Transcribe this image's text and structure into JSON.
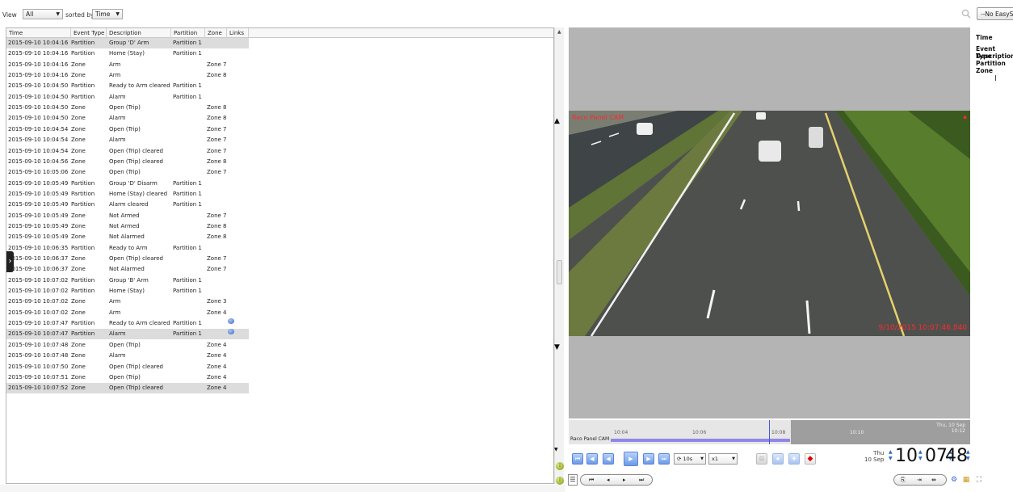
{
  "toolbar": {
    "view_label": "View",
    "view_value": "All",
    "sorted_label": "sorted by",
    "sorted_value": "Time",
    "easy_button": "--No EasySe"
  },
  "table": {
    "columns": [
      "Time",
      "Event Type",
      "Description",
      "Partition",
      "Zone",
      "Links"
    ],
    "rows": [
      {
        "time": "2015-09-10 10:04:16",
        "type": "Partition",
        "desc": "Group 'D' Arm",
        "partition": "Partition 1",
        "zone": "",
        "link": false,
        "selected": true
      },
      {
        "time": "2015-09-10 10:04:16",
        "type": "Partition",
        "desc": "Home (Stay)",
        "partition": "Partition 1",
        "zone": "",
        "link": false,
        "selected": false
      },
      {
        "time": "2015-09-10 10:04:16",
        "type": "Zone",
        "desc": "Arm",
        "partition": "",
        "zone": "Zone 7",
        "link": false,
        "selected": false
      },
      {
        "time": "2015-09-10 10:04:16",
        "type": "Zone",
        "desc": "Arm",
        "partition": "",
        "zone": "Zone 8",
        "link": false,
        "selected": false
      },
      {
        "time": "2015-09-10 10:04:50",
        "type": "Partition",
        "desc": "Ready to Arm cleared",
        "partition": "Partition 1",
        "zone": "",
        "link": false,
        "selected": false
      },
      {
        "time": "2015-09-10 10:04:50",
        "type": "Partition",
        "desc": "Alarm",
        "partition": "Partition 1",
        "zone": "",
        "link": false,
        "selected": false
      },
      {
        "time": "2015-09-10 10:04:50",
        "type": "Zone",
        "desc": "Open (Trip)",
        "partition": "",
        "zone": "Zone 8",
        "link": false,
        "selected": false
      },
      {
        "time": "2015-09-10 10:04:50",
        "type": "Zone",
        "desc": "Alarm",
        "partition": "",
        "zone": "Zone 8",
        "link": false,
        "selected": false
      },
      {
        "time": "2015-09-10 10:04:54",
        "type": "Zone",
        "desc": "Open (Trip)",
        "partition": "",
        "zone": "Zone 7",
        "link": false,
        "selected": false
      },
      {
        "time": "2015-09-10 10:04:54",
        "type": "Zone",
        "desc": "Alarm",
        "partition": "",
        "zone": "Zone 7",
        "link": false,
        "selected": false
      },
      {
        "time": "2015-09-10 10:04:54",
        "type": "Zone",
        "desc": "Open (Trip) cleared",
        "partition": "",
        "zone": "Zone 7",
        "link": false,
        "selected": false
      },
      {
        "time": "2015-09-10 10:04:56",
        "type": "Zone",
        "desc": "Open (Trip) cleared",
        "partition": "",
        "zone": "Zone 8",
        "link": false,
        "selected": false
      },
      {
        "time": "2015-09-10 10:05:06",
        "type": "Zone",
        "desc": "Open (Trip)",
        "partition": "",
        "zone": "Zone 7",
        "link": false,
        "selected": false
      },
      {
        "time": "2015-09-10 10:05:49",
        "type": "Partition",
        "desc": "Group 'D' Disarm",
        "partition": "Partition 1",
        "zone": "",
        "link": false,
        "selected": false
      },
      {
        "time": "2015-09-10 10:05:49",
        "type": "Partition",
        "desc": "Home (Stay) cleared",
        "partition": "Partition 1",
        "zone": "",
        "link": false,
        "selected": false
      },
      {
        "time": "2015-09-10 10:05:49",
        "type": "Partition",
        "desc": "Alarm cleared",
        "partition": "Partition 1",
        "zone": "",
        "link": false,
        "selected": false
      },
      {
        "time": "2015-09-10 10:05:49",
        "type": "Zone",
        "desc": "Not Armed",
        "partition": "",
        "zone": "Zone 7",
        "link": false,
        "selected": false
      },
      {
        "time": "2015-09-10 10:05:49",
        "type": "Zone",
        "desc": "Not Armed",
        "partition": "",
        "zone": "Zone 8",
        "link": false,
        "selected": false
      },
      {
        "time": "2015-09-10 10:05:49",
        "type": "Zone",
        "desc": "Not Alarmed",
        "partition": "",
        "zone": "Zone 8",
        "link": false,
        "selected": false
      },
      {
        "time": "2015-09-10 10:06:35",
        "type": "Partition",
        "desc": "Ready to Arm",
        "partition": "Partition 1",
        "zone": "",
        "link": false,
        "selected": false
      },
      {
        "time": "2015-09-10 10:06:37",
        "type": "Zone",
        "desc": "Open (Trip) cleared",
        "partition": "",
        "zone": "Zone 7",
        "link": false,
        "selected": false
      },
      {
        "time": "2015-09-10 10:06:37",
        "type": "Zone",
        "desc": "Not Alarmed",
        "partition": "",
        "zone": "Zone 7",
        "link": false,
        "selected": false
      },
      {
        "time": "2015-09-10 10:07:02",
        "type": "Partition",
        "desc": "Group 'B' Arm",
        "partition": "Partition 1",
        "zone": "",
        "link": false,
        "selected": false
      },
      {
        "time": "2015-09-10 10:07:02",
        "type": "Partition",
        "desc": "Home (Stay)",
        "partition": "Partition 1",
        "zone": "",
        "link": false,
        "selected": false
      },
      {
        "time": "2015-09-10 10:07:02",
        "type": "Zone",
        "desc": "Arm",
        "partition": "",
        "zone": "Zone 3",
        "link": false,
        "selected": false
      },
      {
        "time": "2015-09-10 10:07:02",
        "type": "Zone",
        "desc": "Arm",
        "partition": "",
        "zone": "Zone 4",
        "link": false,
        "selected": false
      },
      {
        "time": "2015-09-10 10:07:47",
        "type": "Partition",
        "desc": "Ready to Arm cleared",
        "partition": "Partition 1",
        "zone": "",
        "link": true,
        "selected": false
      },
      {
        "time": "2015-09-10 10:07:47",
        "type": "Partition",
        "desc": "Alarm",
        "partition": "Partition 1",
        "zone": "",
        "link": true,
        "selected": true
      },
      {
        "time": "2015-09-10 10:07:48",
        "type": "Zone",
        "desc": "Open (Trip)",
        "partition": "",
        "zone": "Zone 4",
        "link": false,
        "selected": false
      },
      {
        "time": "2015-09-10 10:07:48",
        "type": "Zone",
        "desc": "Alarm",
        "partition": "",
        "zone": "Zone 4",
        "link": false,
        "selected": false
      },
      {
        "time": "2015-09-10 10:07:50",
        "type": "Zone",
        "desc": "Open (Trip) cleared",
        "partition": "",
        "zone": "Zone 4",
        "link": false,
        "selected": false
      },
      {
        "time": "2015-09-10 10:07:51",
        "type": "Zone",
        "desc": "Open (Trip)",
        "partition": "",
        "zone": "Zone 4",
        "link": false,
        "selected": false
      },
      {
        "time": "2015-09-10 10:07:52",
        "type": "Zone",
        "desc": "Open (Trip) cleared",
        "partition": "",
        "zone": "Zone 4",
        "link": false,
        "selected": true
      }
    ]
  },
  "video": {
    "camera_label": "Raco Panel CAM",
    "overlay_timestamp": "9/10/2015 10:07:46.840"
  },
  "detail_panel": {
    "fields": [
      "Time",
      "Event Type",
      "Description",
      "Partition",
      "Zone"
    ]
  },
  "timeline": {
    "ticks": [
      "10:04",
      "10:06",
      "10:08",
      "10:10",
      "10:12"
    ],
    "row_label": "Raco Panel CAM",
    "date_line1": "Thu, 10 Sep",
    "date_line2": "10:12"
  },
  "playback": {
    "step_value": "10s",
    "speed_value": "x1"
  },
  "clock": {
    "day_line1": "Thu",
    "day_line2": "10 Sep",
    "hours": "10",
    "minutes": "07",
    "seconds": "48"
  },
  "colors": {
    "accent": "#5a86d6",
    "overlay_red": "#ff2a2a",
    "timeline_bar": "#8f86e8"
  }
}
